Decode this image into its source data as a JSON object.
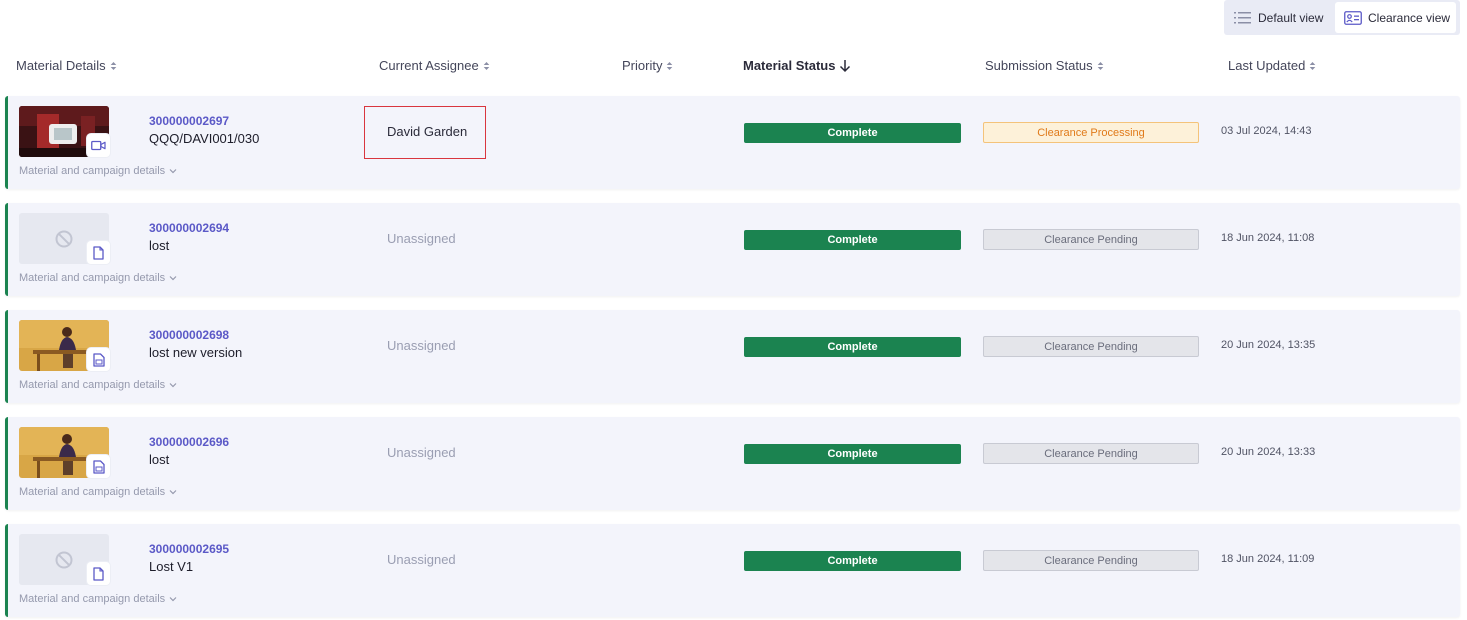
{
  "view_toggle": {
    "default_label": "Default view",
    "clearance_label": "Clearance view"
  },
  "columns": {
    "material_details": "Material Details",
    "current_assignee": "Current Assignee",
    "priority": "Priority",
    "material_status": "Material Status",
    "submission_status": "Submission Status",
    "last_updated": "Last Updated"
  },
  "rows": [
    {
      "id": "300000002697",
      "name": "QQQ/DAVI001/030",
      "details_link": "Material and campaign details",
      "assignee": "David Garden",
      "material_status": "Complete",
      "submission_status": "Clearance Processing",
      "last_updated": "03 Jul 2024, 14:43",
      "thumbnail": "video-still-red-room",
      "type_icon": "video-icon"
    },
    {
      "id": "300000002694",
      "name": "lost",
      "details_link": "Material and campaign details",
      "assignee": "Unassigned",
      "material_status": "Complete",
      "submission_status": "Clearance Pending",
      "last_updated": "18 Jun 2024, 11:08",
      "thumbnail": "no-preview-icon",
      "type_icon": "document-icon"
    },
    {
      "id": "300000002698",
      "name": "lost new version",
      "details_link": "Material and campaign details",
      "assignee": "Unassigned",
      "material_status": "Complete",
      "submission_status": "Clearance Pending",
      "last_updated": "20 Jun 2024, 13:35",
      "thumbnail": "woman-at-desk-image",
      "type_icon": "image-file-icon"
    },
    {
      "id": "300000002696",
      "name": "lost",
      "details_link": "Material and campaign details",
      "assignee": "Unassigned",
      "material_status": "Complete",
      "submission_status": "Clearance Pending",
      "last_updated": "20 Jun 2024, 13:33",
      "thumbnail": "woman-at-desk-image",
      "type_icon": "image-file-icon"
    },
    {
      "id": "300000002695",
      "name": "Lost V1",
      "details_link": "Material and campaign details",
      "assignee": "Unassigned",
      "material_status": "Complete",
      "submission_status": "Clearance Pending",
      "last_updated": "18 Jun 2024, 11:09",
      "thumbnail": "no-preview-icon",
      "type_icon": "document-icon"
    }
  ],
  "colors": {
    "accent": "#5b59c7",
    "complete": "#1b8350",
    "processing_bg": "#fdf1d9",
    "processing_text": "#e07a1a",
    "highlight_box": "#d9363e"
  }
}
